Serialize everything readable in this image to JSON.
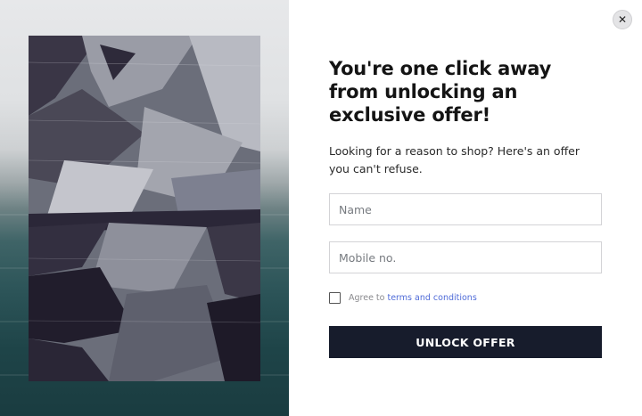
{
  "popup": {
    "close_label": "✕",
    "headline": "You're one click away from unlocking an exclusive offer!",
    "subtext": "Looking for a reason to shop? Here's an offer you can't refuse.",
    "name_placeholder": "Name",
    "mobile_placeholder": "Mobile no.",
    "agree_text": "Agree to",
    "terms_link": "terms and conditions",
    "agree_checked": false,
    "submit_label": "UNLOCK OFFER"
  },
  "colors": {
    "button_bg": "#171c2c",
    "link": "#4f6bd8",
    "headline": "#141414"
  }
}
